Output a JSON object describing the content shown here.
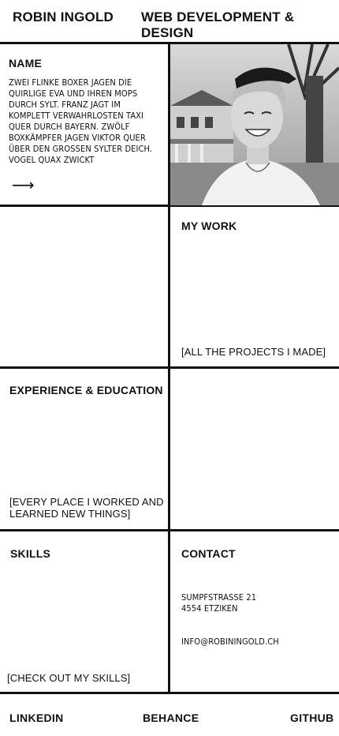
{
  "header": {
    "brand": "ROBIN INGOLD",
    "tagline": "WEB DEVELOPMENT & DESIGN"
  },
  "intro": {
    "title": "NAME",
    "body": "ZWEI FLINKE BOXER JAGEN DIE QUIRLIGE EVA UND IHREN MOPS DURCH SYLT. FRANZ JAGT IM KOMPLETT VERWAHRLOSTEN TAXI QUER DURCH BAYERN. ZWÖLF BOXKÄMPFER JAGEN VIKTOR QUER ÜBER DEN GROßEN SYLTER DEICH. VOGEL QUAX ZWICKT",
    "arrow": "⟶"
  },
  "work": {
    "title": "MY WORK",
    "link": "[ALL THE PROJECTS I MADE]"
  },
  "experience": {
    "title": "EXPERIENCE & EDUCATION",
    "link": "[EVERY PLACE I WORKED AND LEARNED NEW THINGS]"
  },
  "skills": {
    "title": "SKILLS",
    "link": "[CHECK OUT MY SKILLS]"
  },
  "contact": {
    "title": "CONTACT",
    "street": "SUMPFSTRASSE 21",
    "city": "4554 ETZIKEN",
    "email": "INFO@ROBININGOLD.CH"
  },
  "footer": {
    "linkedin": "LINKEDIN",
    "behance": "BEHANCE",
    "github": "GITHUB"
  }
}
